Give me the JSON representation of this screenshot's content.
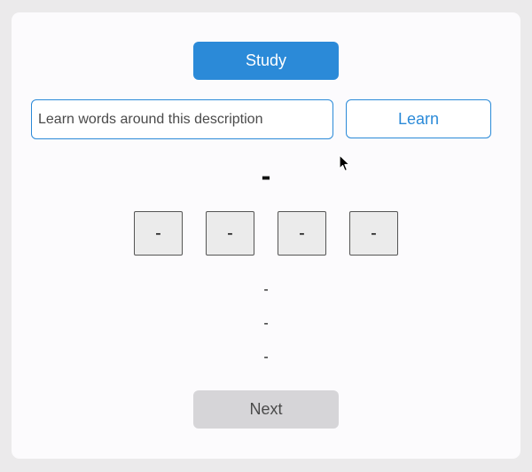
{
  "study_button": {
    "label": "Study"
  },
  "description_input": {
    "value": "",
    "placeholder": "Learn words around this description"
  },
  "learn_button": {
    "label": "Learn"
  },
  "current_word": "-",
  "choices": [
    "-",
    "-",
    "-",
    "-"
  ],
  "details": [
    "-",
    "-",
    "-"
  ],
  "next_button": {
    "label": "Next"
  },
  "colors": {
    "accent": "#2b8ad8",
    "background": "#ebeaeb",
    "card": "#fcfbfd",
    "next_button_bg": "#d6d5d8",
    "choice_bg": "#ebebeb"
  },
  "icons": {
    "cursor": "pointer-arrow-icon"
  }
}
